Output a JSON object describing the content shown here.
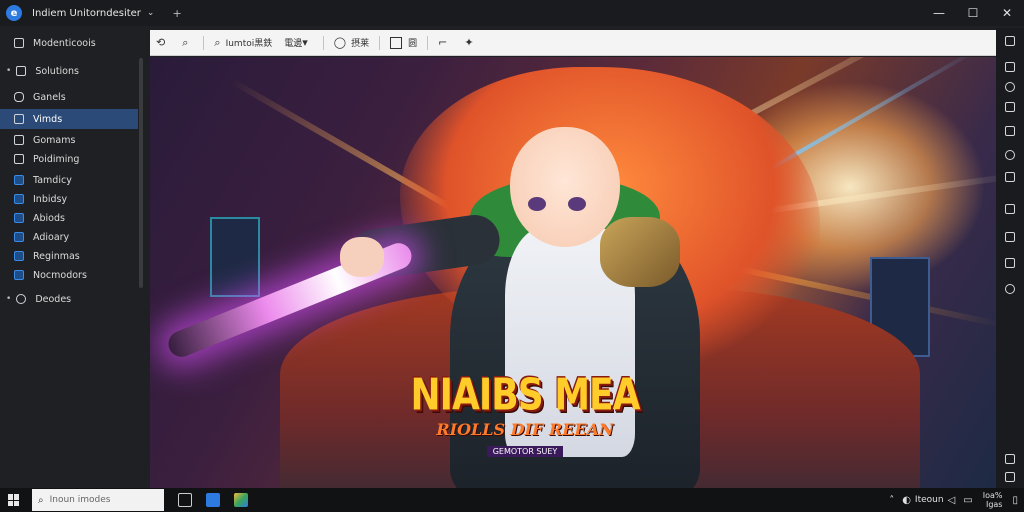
{
  "window": {
    "title": "Indiem Unitorndesiter",
    "controls": [
      "minimize",
      "maximize",
      "close"
    ]
  },
  "sidebar": {
    "items": [
      {
        "label": "Modenticoois",
        "icon": "device-icon"
      },
      {
        "label": "Solutions",
        "icon": "monitor-icon"
      },
      {
        "label": "Ganels",
        "icon": "card-icon"
      },
      {
        "label": "Vimds",
        "icon": "folder-icon",
        "active": true
      },
      {
        "label": "Gomams",
        "icon": "page-icon"
      },
      {
        "label": "Poidiming",
        "icon": "document-icon"
      },
      {
        "label": "Tamdicy",
        "icon": "image-icon"
      },
      {
        "label": "Inbidsy",
        "icon": "image-icon"
      },
      {
        "label": "Abiods",
        "icon": "image-icon"
      },
      {
        "label": "Adioary",
        "icon": "image-icon"
      },
      {
        "label": "Reginmas",
        "icon": "image-icon"
      },
      {
        "label": "Nocmodors",
        "icon": "image-icon"
      },
      {
        "label": "Deodes",
        "icon": "key-icon"
      }
    ]
  },
  "toolbar": {
    "buttons": [
      {
        "label": "",
        "icon": "rotate-icon"
      },
      {
        "label": "",
        "icon": "search-icon"
      },
      {
        "label": "Iumtoi黒鉄",
        "icon": "zoom-icon"
      },
      {
        "label": "電邊 ",
        "icon": "grid-icon"
      },
      {
        "label": "摂莱",
        "icon": "circle-icon"
      },
      {
        "label": "圆",
        "icon": "frame-icon"
      },
      {
        "label": "",
        "icon": "crop-icon"
      },
      {
        "label": "",
        "icon": "pin-icon"
      }
    ]
  },
  "image": {
    "logo_main": "NIAIBS MEA",
    "logo_sub": "RIOLLS DIF REEAN",
    "logo_tag": "GEMOTOR SUEY"
  },
  "taskbar": {
    "search_placeholder": "Inoun imodes",
    "tray_text": "Iteoun",
    "clock_time": "Ioa%",
    "clock_date": "Igas"
  }
}
